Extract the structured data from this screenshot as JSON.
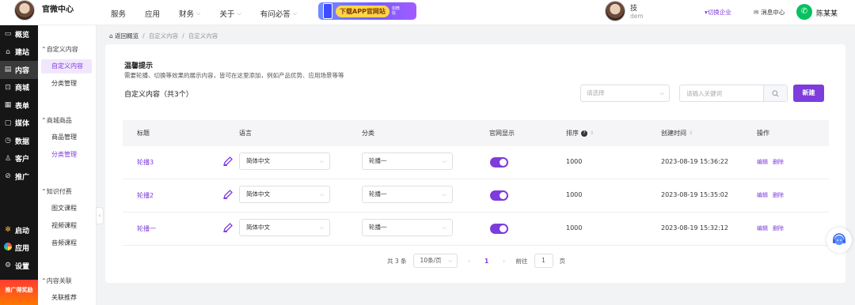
{
  "header": {
    "logo_title": "官微中心",
    "nav": [
      {
        "label": "服务",
        "has_dropdown": false
      },
      {
        "label": "应用",
        "has_dropdown": false
      },
      {
        "label": "财务",
        "has_dropdown": true
      },
      {
        "label": "关于",
        "has_dropdown": true
      },
      {
        "label": "有问必答",
        "has_dropdown": true
      }
    ],
    "promo_label": "下载APP官网站",
    "promo_tag": "加微信",
    "company_name": "技",
    "company_domain": "dem",
    "switch_company": "▾切换企业",
    "message_center": "消息中心",
    "user_name": "陈某某"
  },
  "main_nav": {
    "items": [
      {
        "icon": "home-icon",
        "glyph": "▭",
        "label": "概览"
      },
      {
        "icon": "site-icon",
        "glyph": "⌂",
        "label": "建站"
      },
      {
        "icon": "content-icon",
        "glyph": "▤",
        "label": "内容",
        "active": true
      },
      {
        "icon": "shop-icon",
        "glyph": "⊡",
        "label": "商城"
      },
      {
        "icon": "form-icon",
        "glyph": "▦",
        "label": "表单"
      },
      {
        "icon": "media-icon",
        "glyph": "▢",
        "label": "媒体"
      },
      {
        "icon": "data-icon",
        "glyph": "◷",
        "label": "数据"
      },
      {
        "icon": "customer-icon",
        "glyph": "♙",
        "label": "客户"
      },
      {
        "icon": "promote-icon",
        "glyph": "⊘",
        "label": "推广"
      }
    ],
    "bottom": [
      {
        "icon": "launch-icon",
        "label": "启动"
      },
      {
        "icon": "apps-icon",
        "label": "应用"
      },
      {
        "icon": "settings-icon",
        "glyph": "⚙",
        "label": "设置"
      }
    ],
    "promo_badge": "推广得奖励"
  },
  "sub_nav": {
    "group1": "自定义内容",
    "group1_items": [
      "自定义内容",
      "分类管理"
    ],
    "group2": "商城商品",
    "group2_items": [
      "商品管理",
      "分类管理"
    ],
    "group3": "知识付费",
    "group3_items": [
      "图文课程",
      "视频课程",
      "音频课程"
    ],
    "group4": "内容关联",
    "group4_items": [
      "关联推荐"
    ]
  },
  "breadcrumb": {
    "home": "返回概览",
    "sep": "/",
    "level1": "自定义内容",
    "level2": "自定义内容"
  },
  "tips": {
    "title": "温馨提示",
    "text": "需要轮播、切换等效果的展示内容，皆可在这里添加，例如产品优势、应用场景等等"
  },
  "list": {
    "title": "自定义内容（共3个）",
    "select_placeholder": "请选择",
    "search_placeholder": "请输入关键词",
    "new_button": "新建"
  },
  "table": {
    "headers": [
      "标题",
      "语言",
      "分类",
      "官网显示",
      "排序",
      "创建时间",
      "操作"
    ],
    "rows": [
      {
        "title": "轮播3",
        "language": "简体中文",
        "category": "轮播一",
        "visible": true,
        "order": "1000",
        "created": "2023-08-19 15:36:22",
        "edit": "编辑",
        "delete": "删除"
      },
      {
        "title": "轮播2",
        "language": "简体中文",
        "category": "轮播一",
        "visible": true,
        "order": "1000",
        "created": "2023-08-19 15:35:02",
        "edit": "编辑",
        "delete": "删除"
      },
      {
        "title": "轮播一",
        "language": "简体中文",
        "category": "轮播一",
        "visible": true,
        "order": "1000",
        "created": "2023-08-19 15:32:12",
        "edit": "编辑",
        "delete": "删除"
      }
    ]
  },
  "pagination": {
    "total": "共 3 条",
    "page_size": "10条/页",
    "prev": "‹",
    "current": "1",
    "next": "›",
    "goto_label": "前往",
    "goto_value": "1",
    "page_unit": "页"
  },
  "colors": {
    "accent": "#7d3cdb",
    "sidebar_bg": "#161616",
    "wechat": "#07c160"
  }
}
